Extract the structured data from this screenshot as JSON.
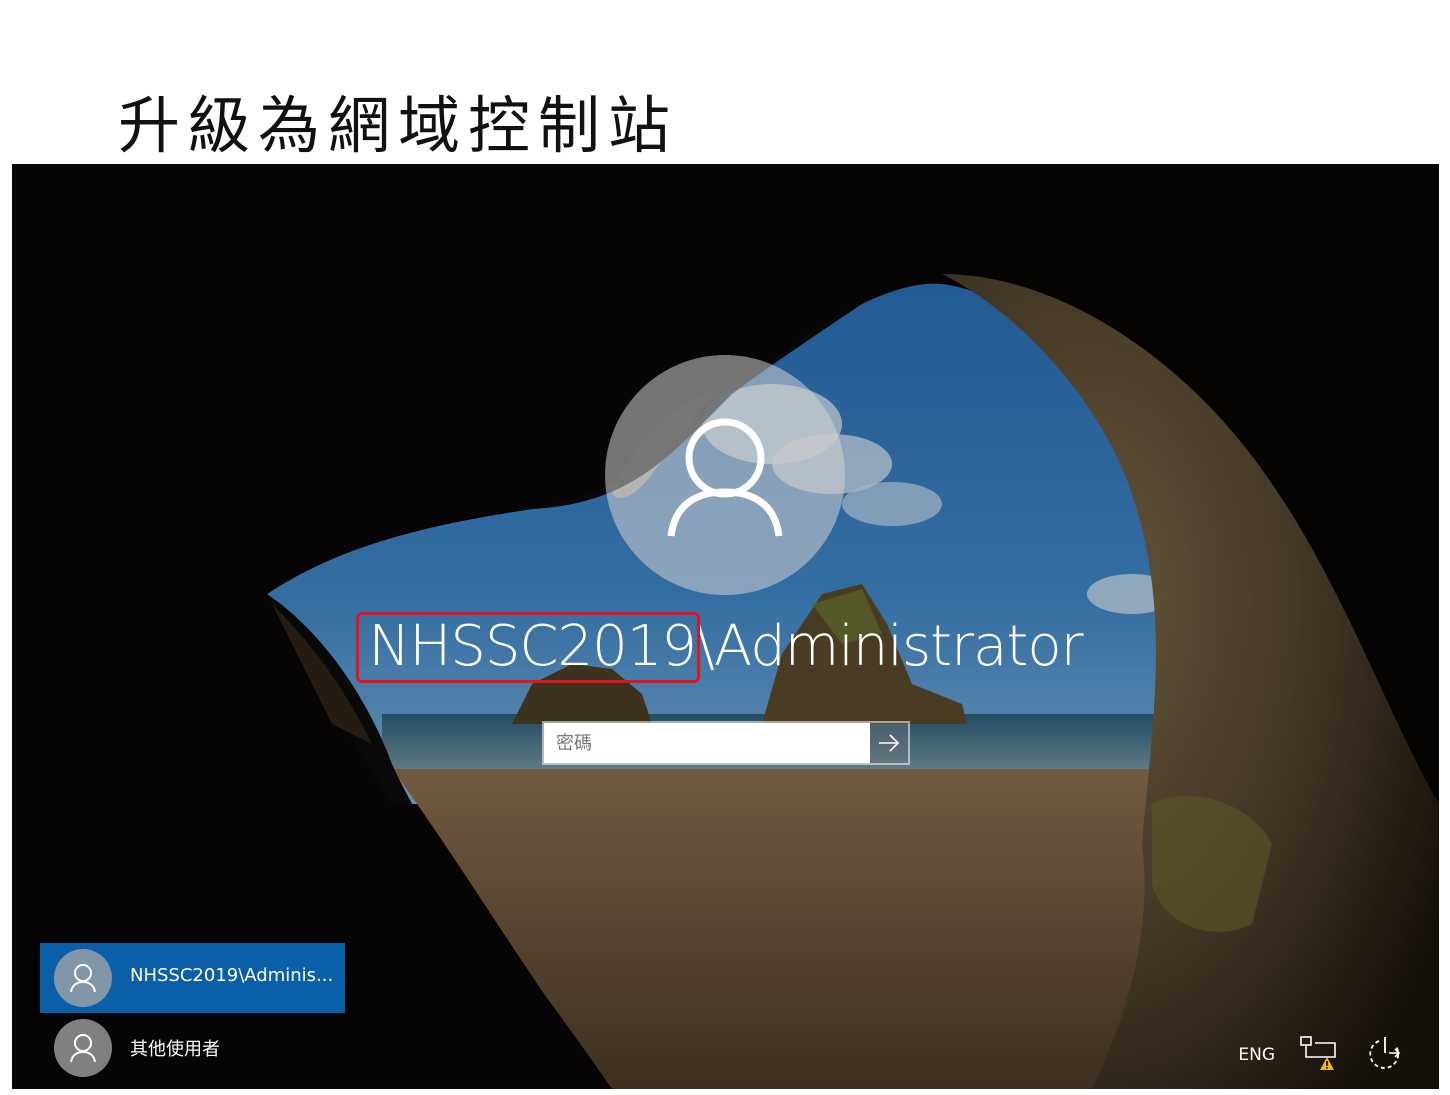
{
  "slide": {
    "title": "升級為網域控制站"
  },
  "login": {
    "username_domain": "NHSSC2019",
    "username_user": "\\Administrator",
    "password_placeholder": "密碼",
    "submit_icon": "arrow-right-icon"
  },
  "user_list": [
    {
      "label": "NHSSC2019\\Adminis...",
      "selected": true
    },
    {
      "label": "其他使用者",
      "selected": false
    }
  ],
  "tray": {
    "language": "ENG",
    "icons": [
      "network-warning-icon",
      "power-icon"
    ]
  },
  "colors": {
    "selected_user": "#0b5ea8",
    "highlight_box": "#e0141e"
  }
}
